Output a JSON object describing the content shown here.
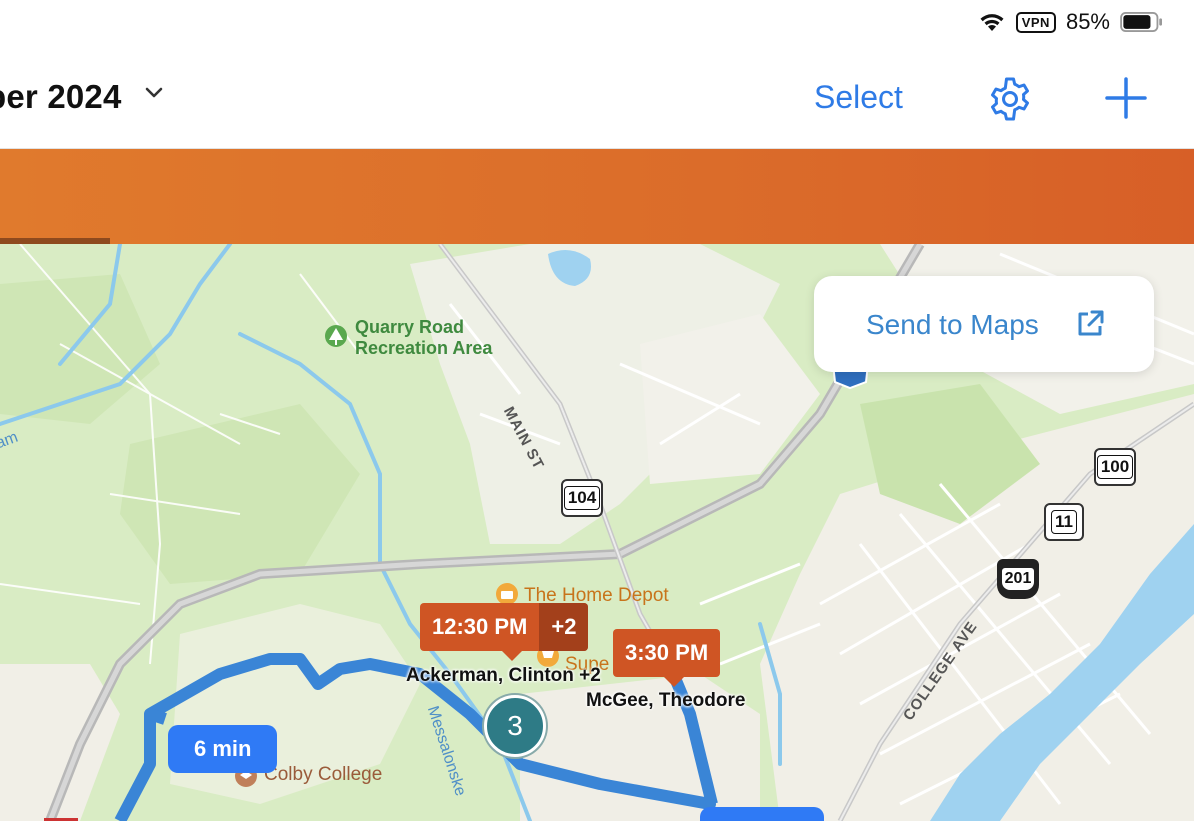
{
  "status_bar": {
    "vpn": "VPN",
    "battery_percent": "85%",
    "battery_level": 0.85
  },
  "nav": {
    "title": "ber 2024",
    "select_label": "Select"
  },
  "map": {
    "send_to_maps_label": "Send to Maps",
    "poi": {
      "quarry_line1": "Quarry Road",
      "quarry_line2": "Recreation Area",
      "home_depot": "The Home Depot",
      "colby": "Colby College",
      "supermarket_partial": "Supe"
    },
    "streets": {
      "main_st": "MAIN ST",
      "college_ave": "COLLEGE AVE",
      "stream": "Messalonske",
      "river_partial": "am"
    },
    "route_shields": [
      "104",
      "100",
      "11",
      "201"
    ],
    "pins": [
      {
        "time": "12:30 PM",
        "extra": "+2",
        "name": "Ackerman, Clinton  +2"
      },
      {
        "time": "3:30 PM",
        "name": "McGee, Theodore"
      }
    ],
    "cluster_count": "3",
    "eta": "6 min"
  }
}
